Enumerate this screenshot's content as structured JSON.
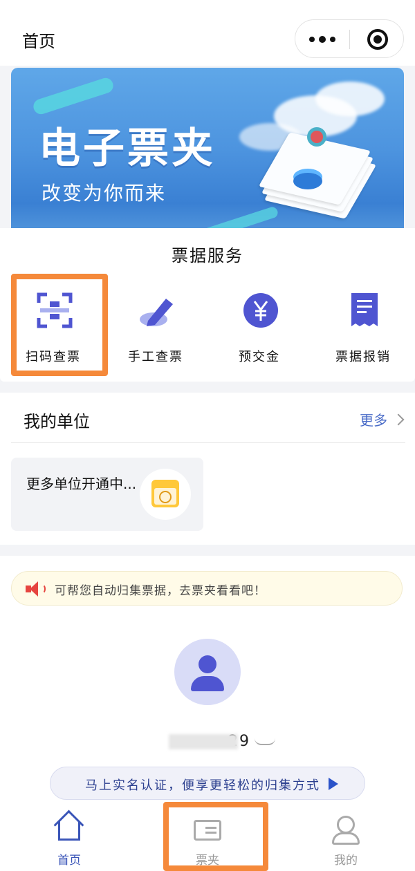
{
  "header": {
    "title": "首页"
  },
  "banner": {
    "title": "电子票夹",
    "subtitle": "改变为你而来"
  },
  "services": {
    "title": "票据服务",
    "items": [
      {
        "label": "扫码查票",
        "icon": "qr-scan-icon",
        "highlighted": true
      },
      {
        "label": "手工查票",
        "icon": "pen-icon",
        "highlighted": false
      },
      {
        "label": "预交金",
        "icon": "yen-icon",
        "highlighted": false
      },
      {
        "label": "票据报销",
        "icon": "receipt-icon",
        "highlighted": false
      }
    ]
  },
  "my_unit": {
    "title": "我的单位",
    "more_label": "更多",
    "card_text": "更多单位开通中..."
  },
  "notice": {
    "text": "可帮您自动归集票据，去票夹看看吧！"
  },
  "profile": {
    "masked_id_end": "29"
  },
  "verify": {
    "text": "马上实名认证，便享更轻松的归集方式"
  },
  "tabbar": {
    "items": [
      {
        "label": "首页",
        "active": true
      },
      {
        "label": "票夹",
        "active": false,
        "highlighted": true
      },
      {
        "label": "我的",
        "active": false
      }
    ]
  },
  "colors": {
    "accent": "#3a55b8",
    "highlight": "#f5893a",
    "icon_blue": "#4f55d1"
  }
}
